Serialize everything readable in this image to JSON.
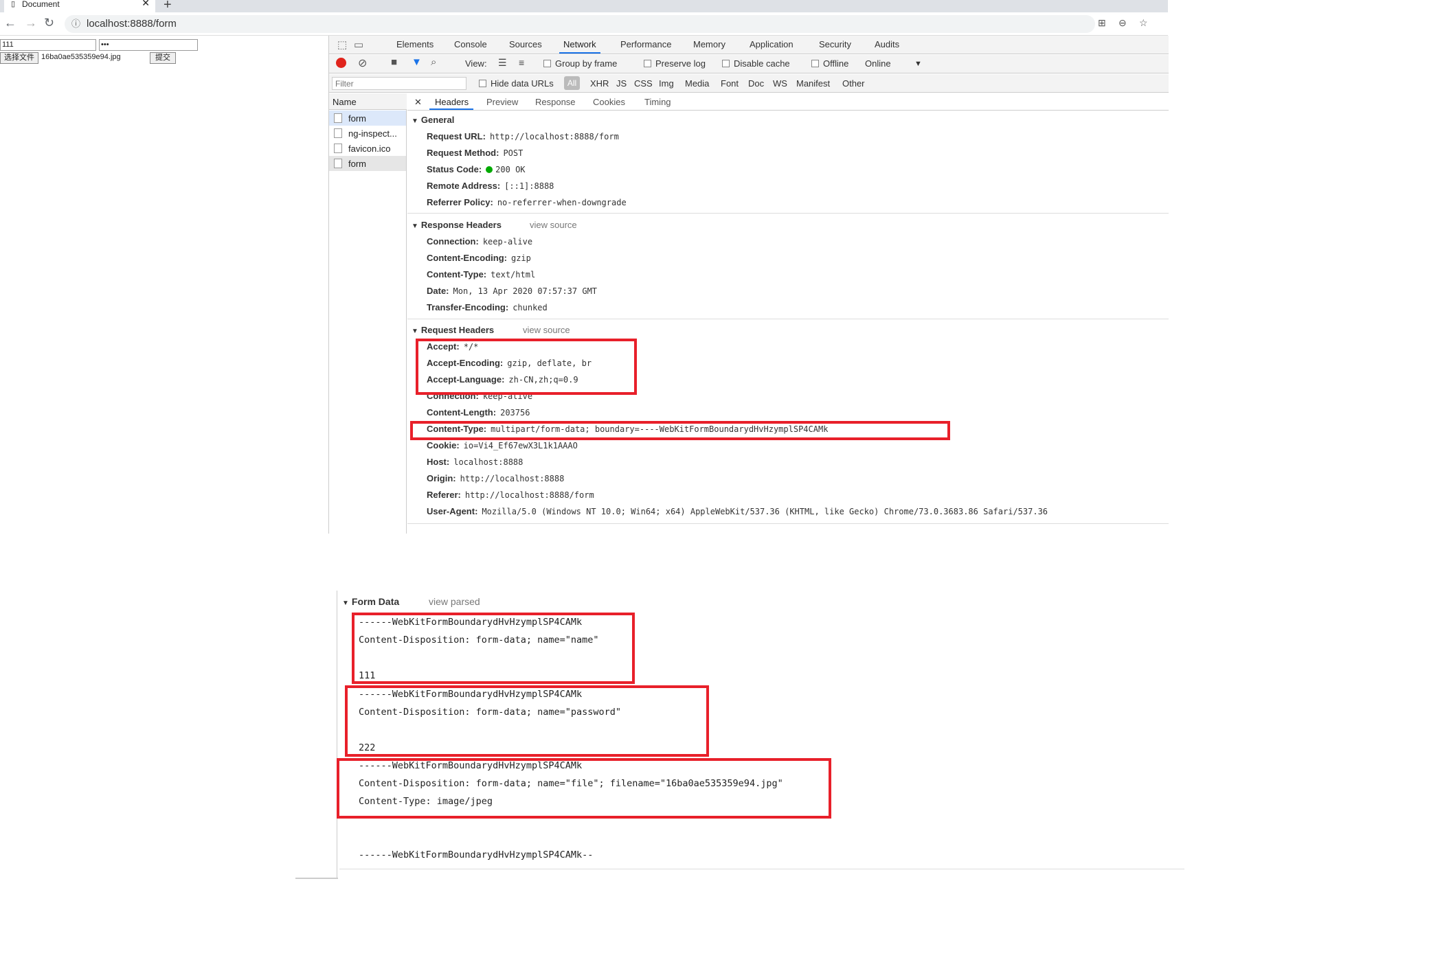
{
  "browser": {
    "tab_title": "Document",
    "tab_close": "✕",
    "new_tab": "+",
    "url": "localhost:8888/form"
  },
  "page": {
    "name_value": "111",
    "password_value": "•••",
    "file_button": "选择文件",
    "file_name": "16ba0ae535359e94.jpg",
    "submit": "提交"
  },
  "devtools": {
    "tabs": [
      "Elements",
      "Console",
      "Sources",
      "Network",
      "Performance",
      "Memory",
      "Application",
      "Security",
      "Audits"
    ],
    "active_tab": "Network",
    "toolbar": {
      "view_label": "View:",
      "group_by_frame": "Group by frame",
      "preserve_log": "Preserve log",
      "disable_cache": "Disable cache",
      "offline": "Offline",
      "online": "Online"
    },
    "filter": {
      "placeholder": "Filter",
      "hide_data_urls": "Hide data URLs",
      "types": [
        "All",
        "XHR",
        "JS",
        "CSS",
        "Img",
        "Media",
        "Font",
        "Doc",
        "WS",
        "Manifest",
        "Other"
      ]
    },
    "name_header": "Name",
    "requests": [
      "form",
      "ng-inspect...",
      "favicon.ico",
      "form"
    ],
    "detail_tabs": [
      "Headers",
      "Preview",
      "Response",
      "Cookies",
      "Timing"
    ],
    "general": {
      "title": "General",
      "rows": [
        {
          "k": "Request URL:",
          "v": "http://localhost:8888/form"
        },
        {
          "k": "Request Method:",
          "v": "POST"
        },
        {
          "k": "Status Code:",
          "v": "200 OK"
        },
        {
          "k": "Remote Address:",
          "v": "[::1]:8888"
        },
        {
          "k": "Referrer Policy:",
          "v": "no-referrer-when-downgrade"
        }
      ]
    },
    "response_headers": {
      "title": "Response Headers",
      "view_source": "view source",
      "rows": [
        {
          "k": "Connection:",
          "v": "keep-alive"
        },
        {
          "k": "Content-Encoding:",
          "v": "gzip"
        },
        {
          "k": "Content-Type:",
          "v": "text/html"
        },
        {
          "k": "Date:",
          "v": "Mon, 13 Apr 2020 07:57:37 GMT"
        },
        {
          "k": "Transfer-Encoding:",
          "v": "chunked"
        }
      ]
    },
    "request_headers": {
      "title": "Request Headers",
      "view_source": "view source",
      "rows": [
        {
          "k": "Accept:",
          "v": "*/*"
        },
        {
          "k": "Accept-Encoding:",
          "v": "gzip, deflate, br"
        },
        {
          "k": "Accept-Language:",
          "v": "zh-CN,zh;q=0.9"
        },
        {
          "k": "Connection:",
          "v": "keep-alive"
        },
        {
          "k": "Content-Length:",
          "v": "203756"
        },
        {
          "k": "Content-Type:",
          "v": "multipart/form-data; boundary=----WebKitFormBoundarydHvHzymplSP4CAMk"
        },
        {
          "k": "Cookie:",
          "v": "io=Vi4_Ef67ewX3L1k1AAAO"
        },
        {
          "k": "Host:",
          "v": "localhost:8888"
        },
        {
          "k": "Origin:",
          "v": "http://localhost:8888"
        },
        {
          "k": "Referer:",
          "v": "http://localhost:8888/form"
        },
        {
          "k": "User-Agent:",
          "v": "Mozilla/5.0 (Windows NT 10.0; Win64; x64) AppleWebKit/537.36 (KHTML, like Gecko) Chrome/73.0.3683.86 Safari/537.36"
        }
      ]
    }
  },
  "form_data": {
    "title": "Form Data",
    "view_parsed": "view parsed",
    "lines": [
      "------WebKitFormBoundarydHvHzymplSP4CAMk",
      "Content-Disposition: form-data; name=\"name\"",
      "",
      "111",
      "------WebKitFormBoundarydHvHzymplSP4CAMk",
      "Content-Disposition: form-data; name=\"password\"",
      "",
      "222",
      "------WebKitFormBoundarydHvHzymplSP4CAMk",
      "Content-Disposition: form-data; name=\"file\"; filename=\"16ba0ae535359e94.jpg\"",
      "Content-Type: image/jpeg",
      "",
      "",
      "------WebKitFormBoundarydHvHzymplSP4CAMk--"
    ]
  },
  "colors": {
    "highlight": "#e8202a",
    "active_tab": "#1a73e8",
    "status_ok": "#00aa00"
  }
}
